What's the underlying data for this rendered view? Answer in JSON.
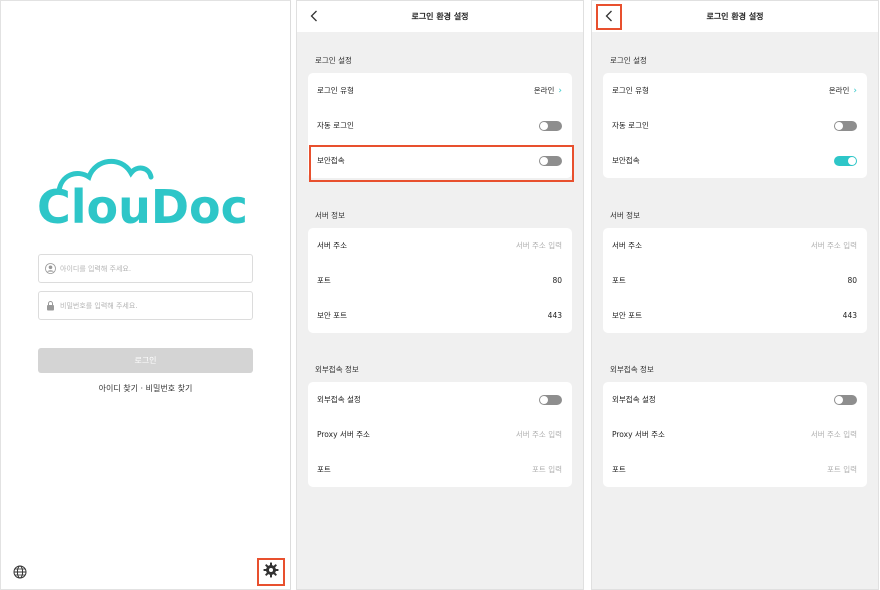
{
  "login": {
    "logo_text": "ClouDoc",
    "id_placeholder": "아이디를 입력해 주세요.",
    "pw_placeholder": "비밀번호를 입력해 주세요.",
    "login_button": "로그인",
    "find_id": "아이디 찾기",
    "separator": "·",
    "find_pw": "비밀번호 찾기",
    "globe_icon": "globe-icon",
    "settings_icon": "gear-icon"
  },
  "settings_a": {
    "title": "로그인 환경 설정",
    "sections": {
      "login": {
        "title": "로그인 설정",
        "login_type_label": "로그인 유형",
        "login_type_value": "온라인",
        "auto_login_label": "자동 로그인",
        "auto_login_on": false,
        "secure_label": "보안접속",
        "secure_on": false
      },
      "server": {
        "title": "서버 정보",
        "address_label": "서버 주소",
        "address_placeholder": "서버 주소 입력",
        "port_label": "포트",
        "port_value": "80",
        "secure_port_label": "보안 포트",
        "secure_port_value": "443"
      },
      "external": {
        "title": "외부접속 정보",
        "ext_label": "외부접속 설정",
        "ext_on": false,
        "proxy_label": "Proxy 서버 주소",
        "proxy_placeholder": "서버 주소 입력",
        "port_label": "포트",
        "port_placeholder": "포트 입력"
      }
    }
  },
  "settings_b": {
    "title": "로그인 환경 설정",
    "sections": {
      "login": {
        "title": "로그인 설정",
        "login_type_label": "로그인 유형",
        "login_type_value": "온라인",
        "auto_login_label": "자동 로그인",
        "auto_login_on": false,
        "secure_label": "보안접속",
        "secure_on": true
      },
      "server": {
        "title": "서버 정보",
        "address_label": "서버 주소",
        "address_placeholder": "서버 주소 입력",
        "port_label": "포트",
        "port_value": "80",
        "secure_port_label": "보안 포트",
        "secure_port_value": "443"
      },
      "external": {
        "title": "외부접속 정보",
        "ext_label": "외부접속 설정",
        "ext_on": false,
        "proxy_label": "Proxy 서버 주소",
        "proxy_placeholder": "서버 주소 입력",
        "port_label": "포트",
        "port_placeholder": "포트 입력"
      }
    }
  },
  "colors": {
    "accent": "#2ec6c8",
    "highlight": "#e8502e",
    "toggle_off": "#8e8e8e",
    "disabled_button": "#d4d4d4"
  }
}
